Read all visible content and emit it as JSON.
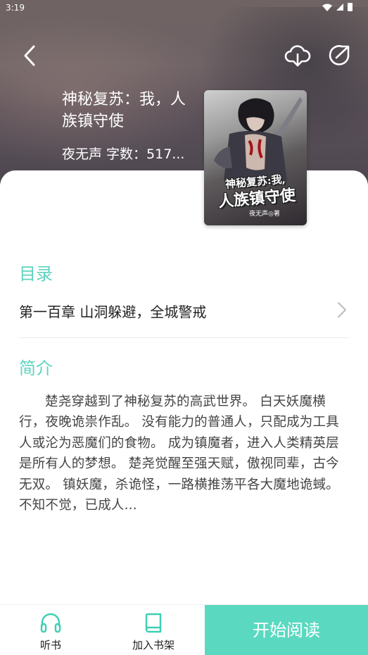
{
  "status_bar": {
    "time": "3:19"
  },
  "header": {
    "back_icon": "back-arrow-icon",
    "download_icon": "cloud-download-icon",
    "share_icon": "share-icon"
  },
  "book": {
    "title": "神秘复苏：我，人族镇守使",
    "author": "夜无声",
    "word_count_label": "字数：517...",
    "cover": {
      "title_line1": "神秘复苏:我,",
      "title_line2": "人族镇守使",
      "author_credit": "夜无声◎著"
    }
  },
  "toc": {
    "heading": "目录",
    "latest_chapter": "第一百章 山洞躲避，全城警戒"
  },
  "intro": {
    "heading": "简介",
    "text": "楚尧穿越到了神秘复苏的高武世界。 白天妖魔横行，夜晚诡祟作乱。 没有能力的普通人，只配成为工具人或沦为恶魔们的食物。 成为镇魔者，进入人类精英层是所有人的梦想。 楚尧觉醒至强天赋，傲视同辈，古今无双。 镇妖魔，杀诡怪，一路横推荡平各大魔地诡蜮。 不知不觉，已成人..."
  },
  "bottom_bar": {
    "listen_label": "听书",
    "shelf_label": "加入书架",
    "read_label": "开始阅读"
  },
  "colors": {
    "accent": "#5ED4BF",
    "read_button": "#5AD9C0"
  }
}
